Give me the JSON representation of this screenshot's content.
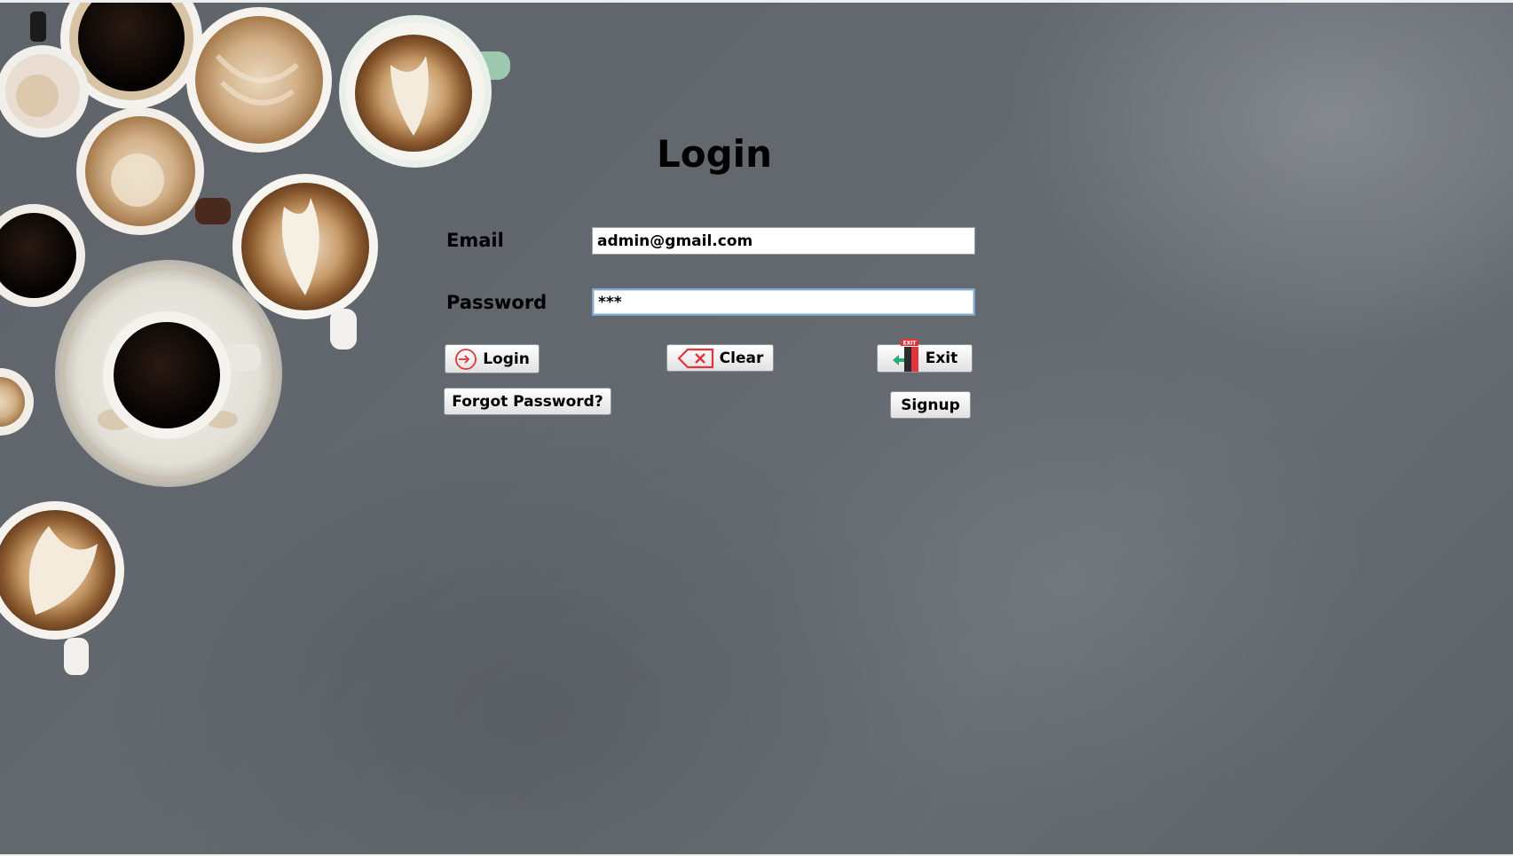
{
  "form": {
    "title": "Login",
    "email_label": "Email",
    "email_value": "admin@gmail.com",
    "password_label": "Password",
    "password_value": "***"
  },
  "buttons": {
    "login": "Login",
    "clear": "Clear",
    "exit": "Exit",
    "forgot": "Forgot Password?",
    "signup": "Signup"
  },
  "icons": {
    "login": "login-arrow-icon",
    "clear": "backspace-clear-icon",
    "exit": "exit-door-icon",
    "exit_sign_text": "EXIT"
  },
  "colors": {
    "background": "#62686e",
    "icon_red": "#e2343c",
    "icon_green": "#27ae73"
  }
}
